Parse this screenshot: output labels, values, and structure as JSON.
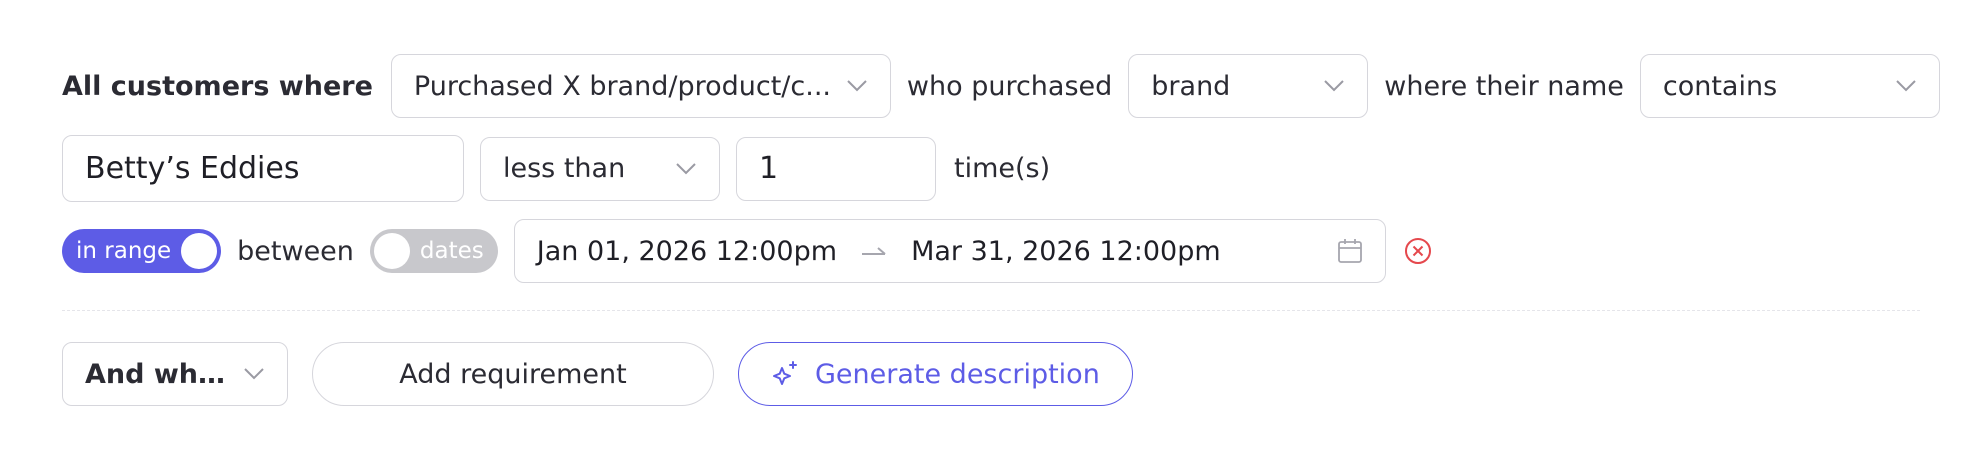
{
  "rule": {
    "prefix": "All customers where",
    "condition_select": "Purchased X brand/product/c...",
    "who_label": "who purchased",
    "item_type_select": "brand",
    "name_label": "where their name",
    "match_select": "contains",
    "name_value": "Betty’s Eddies",
    "comparison_select": "less than",
    "count_value": "1",
    "count_unit": "time(s)",
    "range_toggle": {
      "label": "in range",
      "on": true
    },
    "between_label": "between",
    "dates_toggle": {
      "label": "dates",
      "on": false
    },
    "date_from": "Jan 01, 2026 12:00pm",
    "date_to": "Mar 31, 2026 12:00pm"
  },
  "footer": {
    "joiner_select": "And where",
    "add_requirement": "Add requirement",
    "generate_description": "Generate description"
  },
  "icons": {
    "chevron": "chevron-down-icon",
    "arrow": "arrow-right-icon",
    "calendar": "calendar-icon",
    "clear": "clear-circle-icon",
    "sparkle": "sparkle-icon"
  },
  "colors": {
    "accent": "#5d5ce6",
    "border": "#d6d6dc",
    "danger": "#e5484d",
    "toggle_off": "#c8c8cc"
  }
}
